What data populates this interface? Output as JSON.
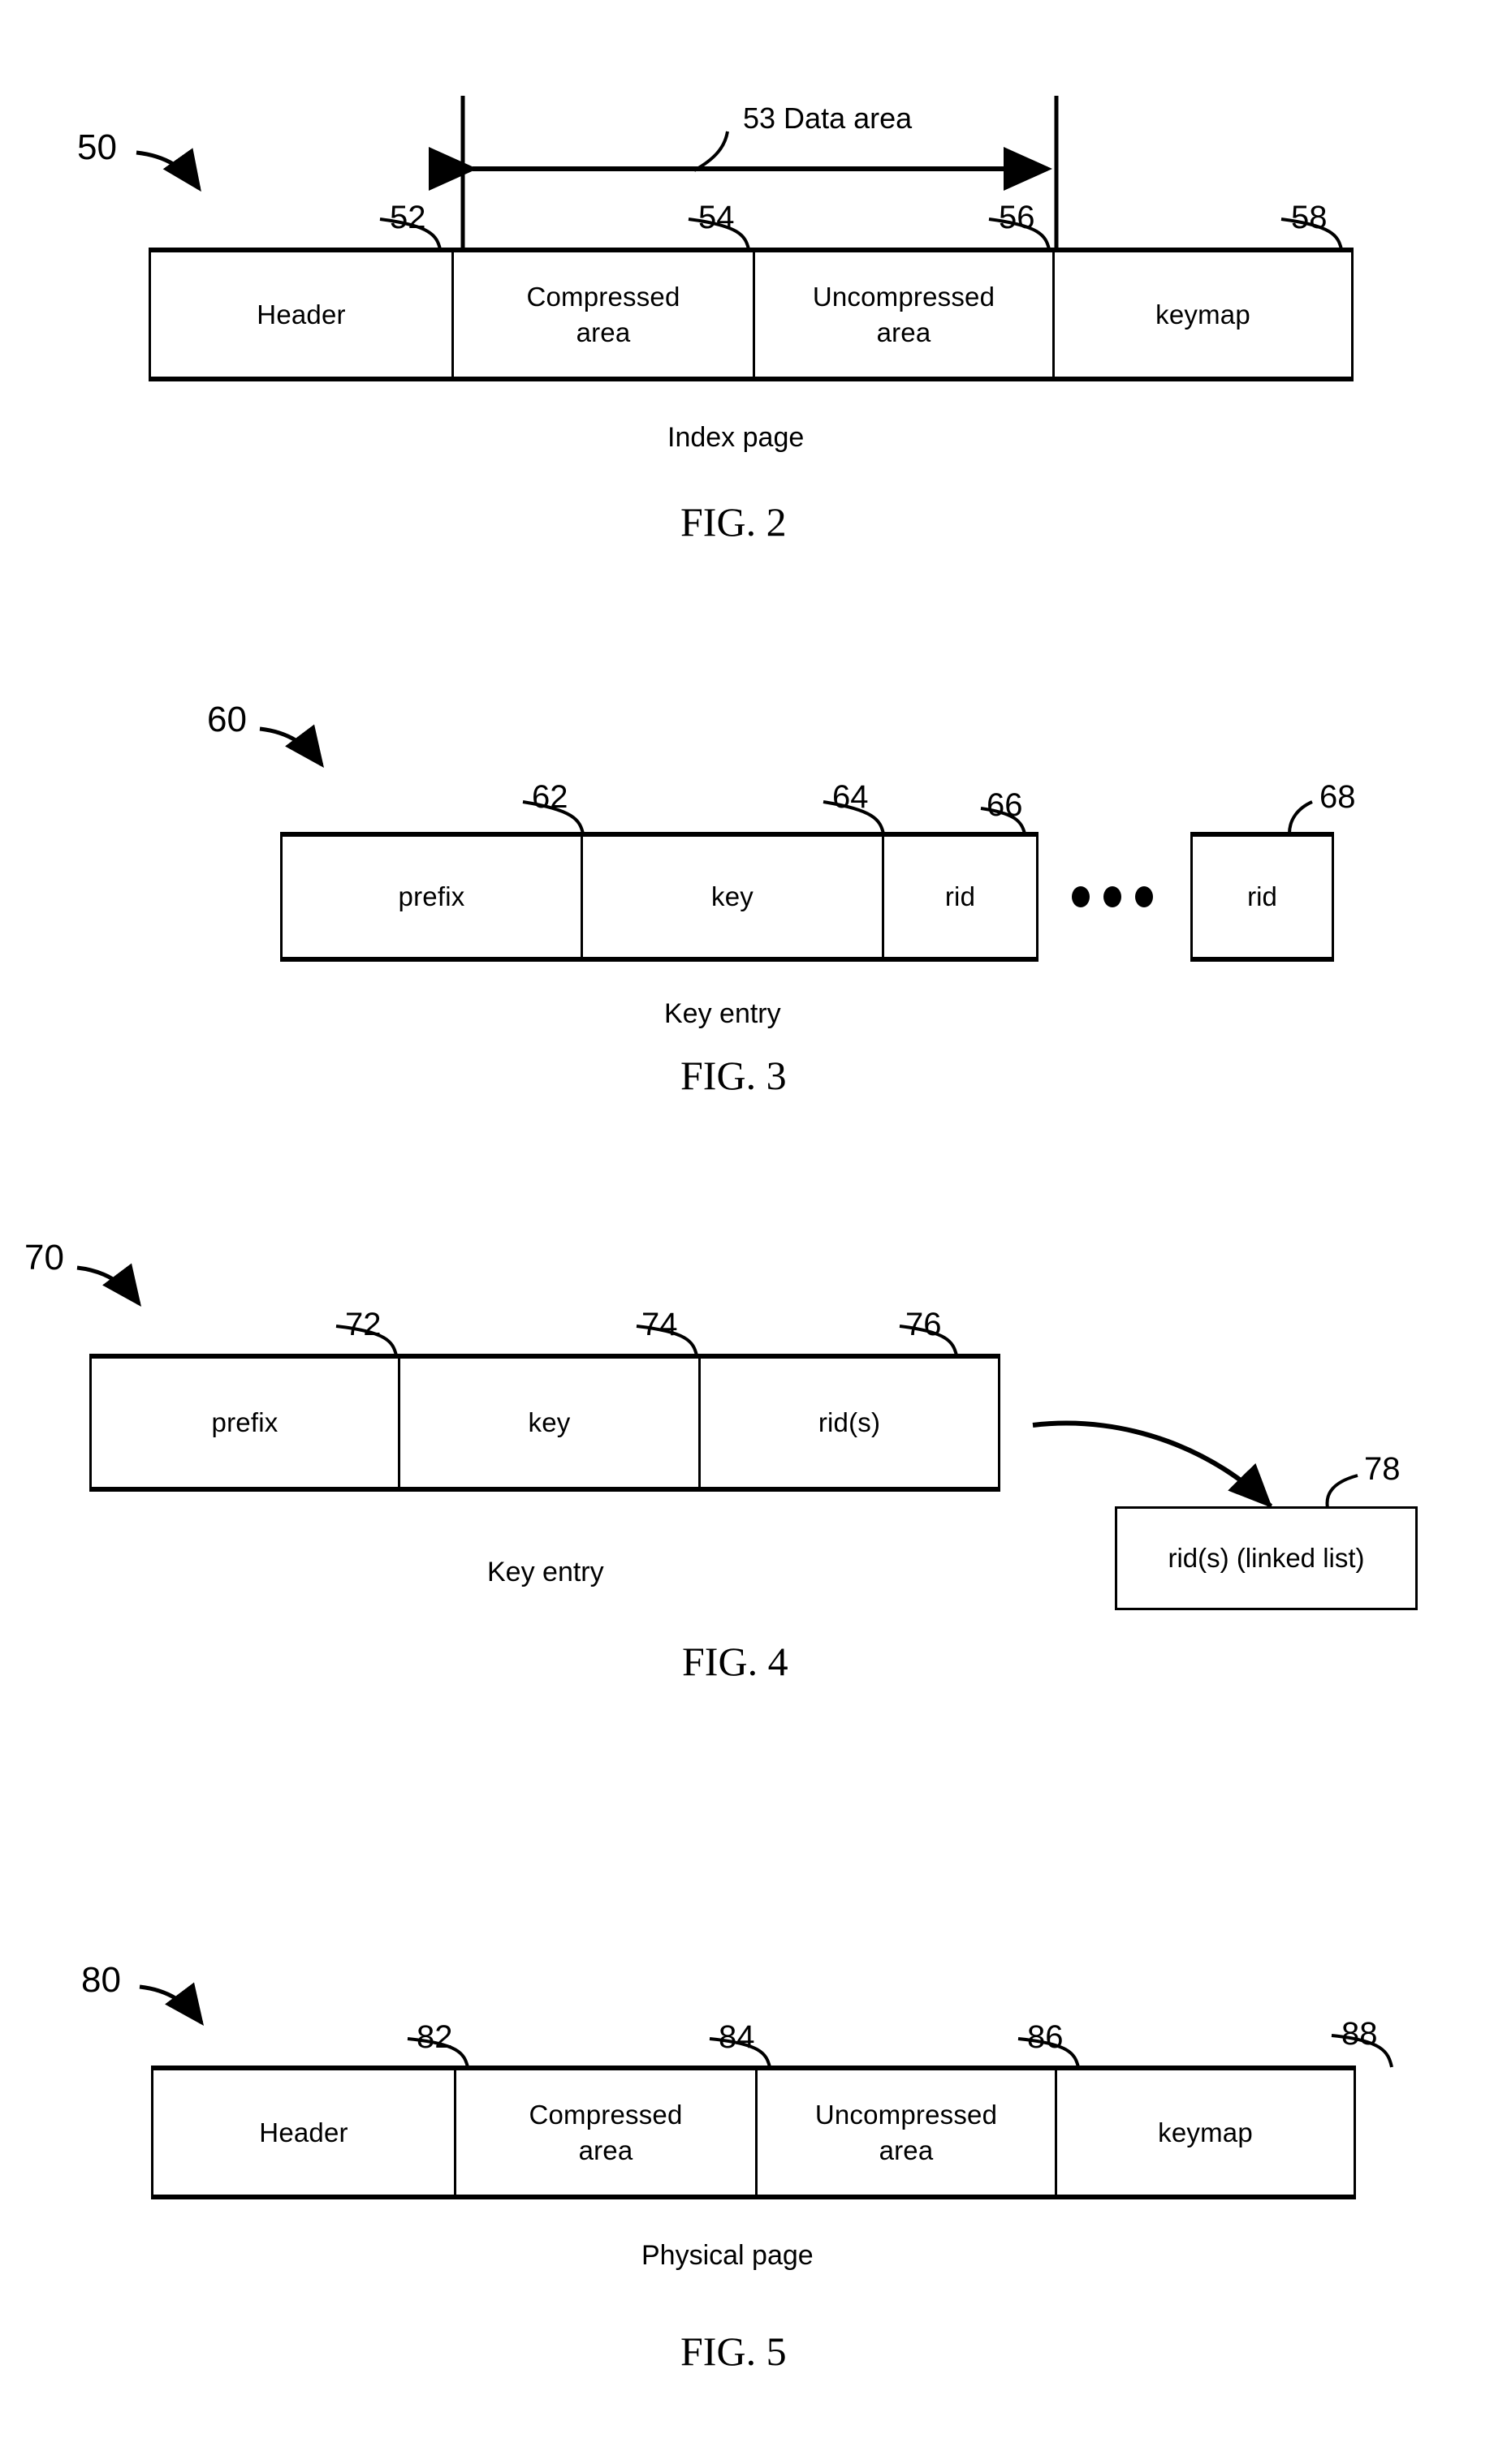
{
  "document": {
    "kind": "patent-drawing-sheet",
    "figure_count": 4
  },
  "figures": [
    {
      "id": "fig2",
      "fig_label": "FIG. 2",
      "caption": "Index page",
      "assembly_ref": "50",
      "annotation": {
        "ref": "53",
        "text": "Data area",
        "combined": "53  Data area"
      },
      "cells": [
        {
          "ref": "52",
          "label": "Header"
        },
        {
          "ref": "54",
          "label_line1": "Compressed",
          "label_line2": "area"
        },
        {
          "ref": "56",
          "label_line1": "Uncompressed",
          "label_line2": "area"
        },
        {
          "ref": "58",
          "label": "keymap"
        }
      ]
    },
    {
      "id": "fig3",
      "fig_label": "FIG. 3",
      "caption": "Key entry",
      "assembly_ref": "60",
      "ellipsis_dot_count": 3,
      "cells": [
        {
          "ref": "62",
          "label": "prefix"
        },
        {
          "ref": "64",
          "label": "key"
        },
        {
          "ref": "66",
          "label": "rid"
        }
      ],
      "detached_cell": {
        "ref": "68",
        "label": "rid"
      }
    },
    {
      "id": "fig4",
      "fig_label": "FIG. 4",
      "caption": "Key entry",
      "assembly_ref": "70",
      "cells": [
        {
          "ref": "72",
          "label": "prefix"
        },
        {
          "ref": "74",
          "label": "key"
        },
        {
          "ref": "76",
          "label": "rid(s)"
        }
      ],
      "linked_box": {
        "ref": "78",
        "label_line1": "rid(s)",
        "label_line2": "(linked list)"
      }
    },
    {
      "id": "fig5",
      "fig_label": "FIG. 5",
      "caption": "Physical page",
      "assembly_ref": "80",
      "cells": [
        {
          "ref": "82",
          "label": "Header"
        },
        {
          "ref": "84",
          "label_line1": "Compressed",
          "label_line2": "area"
        },
        {
          "ref": "86",
          "label_line1": "Uncompressed",
          "label_line2": "area"
        },
        {
          "ref": "88",
          "label": "keymap"
        }
      ]
    }
  ],
  "colors": {
    "ink": "#000000",
    "paper": "#ffffff"
  }
}
